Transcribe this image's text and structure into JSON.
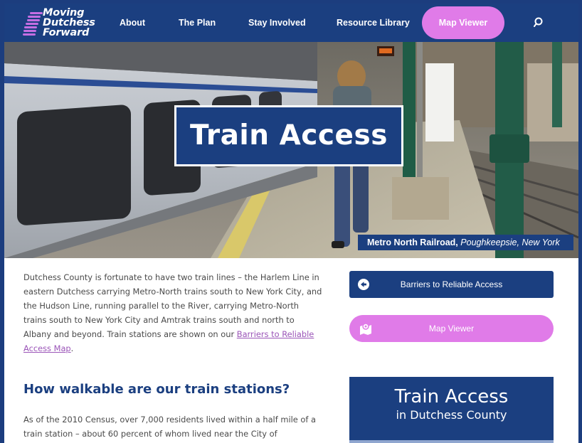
{
  "header": {
    "logo": {
      "line1": "Moving",
      "line2": "Dutchess",
      "line3": "Forward"
    },
    "nav": [
      {
        "label": "About"
      },
      {
        "label": "The Plan"
      },
      {
        "label": "Stay Involved"
      },
      {
        "label": "Resource Library"
      }
    ],
    "nav_cta": {
      "label": "Map Viewer"
    },
    "search_icon": "search-icon"
  },
  "hero": {
    "title": "Train Access",
    "caption_bold": "Metro North Railroad,",
    "caption_italic": "Poughkeepsie, New York"
  },
  "content": {
    "intro_text": "Dutchess County is fortunate to have two train lines – the Harlem Line in eastern Dutchess carrying Metro-North trains south to New York City, and the Hudson Line, running parallel to the River, carrying Metro-North trains south to New York City and Amtrak trains south and north to Albany and beyond. Train stations are shown on our ",
    "intro_link": "Barriers to Reliable Access Map",
    "intro_end": ".",
    "heading": "How walkable are our train stations?",
    "body_text": "As of the 2010 Census, over 7,000 residents lived within a half mile of a train station – about 60 percent of whom lived near the City of"
  },
  "sidebar": {
    "barriers_button": {
      "label": "Barriers to Reliable Access",
      "icon": "arrow-left-circle-icon"
    },
    "map_button": {
      "label": "Map Viewer",
      "icon": "map-marker-icon"
    },
    "promo": {
      "title": "Train Access",
      "subtitle": "in Dutchess County"
    }
  },
  "colors": {
    "brand_navy": "#1b3f80",
    "accent_pink": "#e07be8",
    "link_purple": "#9b55b8"
  }
}
